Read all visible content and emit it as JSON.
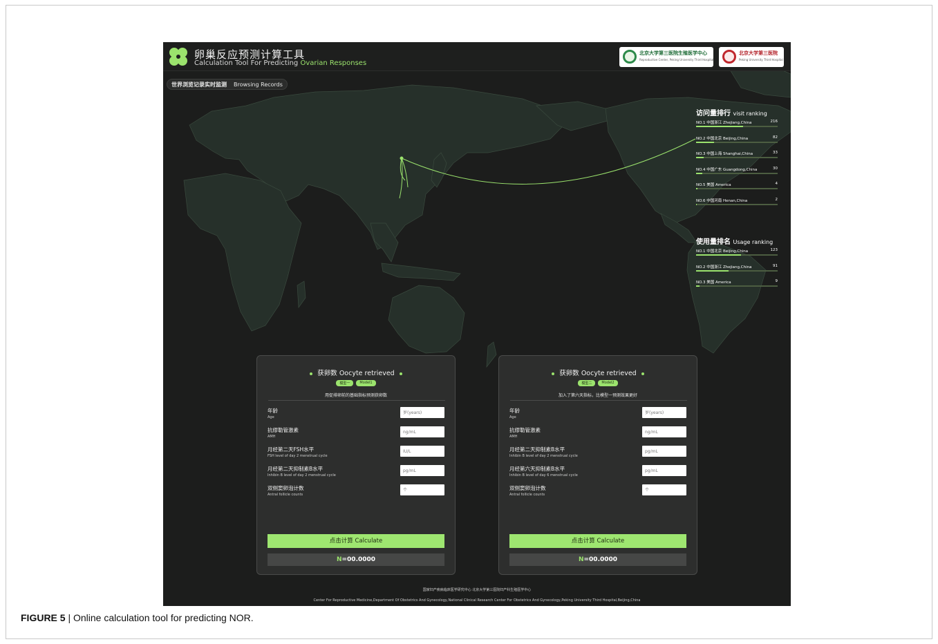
{
  "header": {
    "title_cn": "卵巢反应预测计算工具",
    "title_en_prefix": "Calculation Tool For Predicting ",
    "title_en_highlight": "Ovarian Responses",
    "partners": [
      {
        "name": "北京大学第三医院生殖医学中心",
        "sub": "Reproductive Center, Peking University Third Hospital"
      },
      {
        "name": "北京大学第三医院",
        "sub": "Peking University Third Hospital"
      }
    ]
  },
  "tabs": [
    "世界浏览记录实时监测",
    "Browsing Records"
  ],
  "visit_ranking": {
    "title": "访问量排行",
    "title_en": "visit ranking",
    "items": [
      {
        "label": "NO.1 中国浙江  Zhejiang,China",
        "value": "216",
        "ratio": 0.58
      },
      {
        "label": "NO.2 中国北京  Beijing,China",
        "value": "82",
        "ratio": 0.22
      },
      {
        "label": "NO.3 中国上海  Shanghai,China",
        "value": "33",
        "ratio": 0.09
      },
      {
        "label": "NO.4 中国广东  Guangdong,China",
        "value": "30",
        "ratio": 0.08
      },
      {
        "label": "NO.5 美国  America",
        "value": "4",
        "ratio": 0.02
      },
      {
        "label": "NO.6 中国河南  Henan,China",
        "value": "2",
        "ratio": 0.01
      }
    ]
  },
  "usage_ranking": {
    "title": "使用量排名",
    "title_en": "Usage ranking",
    "items": [
      {
        "label": "NO.1 中国北京  Beijing,China",
        "value": "123",
        "ratio": 0.55
      },
      {
        "label": "NO.2 中国浙江  Zhejiang,China",
        "value": "91",
        "ratio": 0.4
      },
      {
        "label": "NO.3 美国  America",
        "value": "9",
        "ratio": 0.04
      }
    ]
  },
  "cards": [
    {
      "title": "获卵数 Oocyte retrieved",
      "badge_cn": "模型一",
      "badge_en": "Model1",
      "desc": "用促排卵前的基础指标预测获卵数",
      "fields": [
        {
          "cn": "年龄",
          "en": "Age",
          "placeholder": "岁(years)"
        },
        {
          "cn": "抗缪勒管激素",
          "en": "AMH",
          "placeholder": "ng/mL"
        },
        {
          "cn": "月经第二天FSH水平",
          "en": "FSH level of day 2 menstrual cycle",
          "placeholder": "IU/L"
        },
        {
          "cn": "月经第二天抑制素B水平",
          "en": "Inhibin B level of day 2 menstrual cycle",
          "placeholder": "pg/mL"
        },
        {
          "cn": "双侧窦卵泡计数",
          "en": "Antral follicle counts",
          "placeholder": "个"
        }
      ],
      "button": "点击计算 Calculate",
      "result_label": "N",
      "result_value": "=00.0000"
    },
    {
      "title": "获卵数 Oocyte retrieved",
      "badge_cn": "模型二",
      "badge_en": "Model2",
      "desc": "加入了第六天指标，比模型一预测效果更好",
      "fields": [
        {
          "cn": "年龄",
          "en": "Age",
          "placeholder": "岁(years)"
        },
        {
          "cn": "抗缪勒管激素",
          "en": "AMH",
          "placeholder": "ng/mL"
        },
        {
          "cn": "月经第二天抑制素B水平",
          "en": "Inhibin B level of day 2 menstrual cycle",
          "placeholder": "pg/mL"
        },
        {
          "cn": "月经第六天抑制素B水平",
          "en": "Inhibin B level of day 6 menstrual cycle",
          "placeholder": "pg/mL"
        },
        {
          "cn": "双侧窦卵泡计数",
          "en": "Antral follicle counts",
          "placeholder": "个"
        }
      ],
      "button": "点击计算 Calculate",
      "result_label": "N",
      "result_value": "=00.0000"
    }
  ],
  "footer": {
    "line1": "国家妇产疾病临床医学研究中心  北京大学第三医院妇产科生殖医学中心",
    "line2": "Center For Reproductive Medicine,Department Of Obstetrics And Gynecology,National Clinical Research Center For Obstetrics And Gynecology,Peking University Third Hospital,Beijing,China"
  },
  "caption": {
    "label": "FIGURE 5",
    "text": " | Online calculation tool for predicting NOR."
  },
  "colors": {
    "accent": "#9be36d",
    "background": "#1c1d1c",
    "land": "#26302a",
    "card": "#2d2e2d"
  }
}
